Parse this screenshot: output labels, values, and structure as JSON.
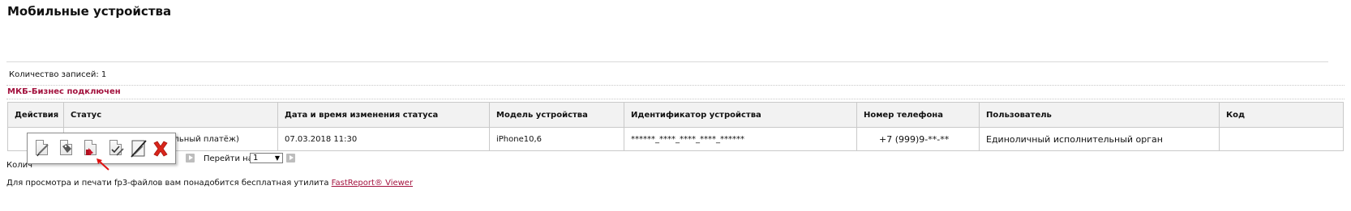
{
  "page": {
    "title": "Мобильные устройства"
  },
  "records_count": "Количество записей: 1",
  "mkb_status": "МКБ-Бизнес подключен",
  "table": {
    "headers": [
      "Действия",
      "Статус",
      "Дата и время изменения статуса",
      "Модель устройства",
      "Идентификатор устройства",
      "Номер телефона",
      "Пользователь",
      "Код"
    ],
    "rows": [
      {
        "status": "Доступ разрешен (Мобильный платёж)",
        "changed_at": "07.03.2018 11:30",
        "model": "iPhone10,6",
        "device_id": "******_****_****_****_******",
        "phone": "+7 (999)9-**-**",
        "user": "Единоличный исполнительный орган",
        "code": ""
      }
    ]
  },
  "footer": {
    "count_label_partial": "Колич",
    "goto_label": "Перейти на:",
    "goto_value": "1"
  },
  "popup_menu": {
    "items": [
      {
        "icon": "edit-document-icon"
      },
      {
        "icon": "tag-document-icon"
      },
      {
        "icon": "red-document-icon"
      },
      {
        "icon": "sign-document-icon"
      },
      {
        "icon": "disable-signature-icon"
      },
      {
        "icon": "delete-icon"
      }
    ]
  },
  "note": {
    "text": "Для просмотра и печати fp3-файлов вам понадобится бесплатная утилита ",
    "link": "FastReport® Viewer"
  },
  "colors": {
    "accent": "#a3123e",
    "header_bg": "#f2f2f2",
    "border": "#c9c9c9",
    "delete_red": "#d9261c"
  }
}
